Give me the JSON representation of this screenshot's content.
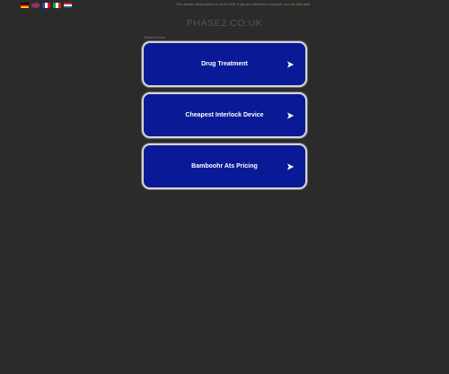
{
  "topbar": {
    "flags": [
      "flag-de-icon",
      "flag-gb-icon",
      "flag-fr-icon",
      "flag-it-icon",
      "flag-nl-icon"
    ],
    "disclaimer_text": "This domain name expired on 01.01.2024. If you are interested in buying it, you can",
    "disclaimer_link": "click here"
  },
  "domain": {
    "title": "PHASE2.CO.UK"
  },
  "related": {
    "label": "Related Links",
    "links": [
      {
        "label": "Drug Treatment"
      },
      {
        "label": "Cheapest Interlock Device"
      },
      {
        "label": "Bamboohr Ats Pricing"
      }
    ]
  },
  "colors": {
    "background": "#2b2b2b",
    "link_box": "#0a1a96",
    "link_border": "#d7d7d7",
    "link_text": "#ffffff",
    "disclaimer_link": "#c8962c"
  }
}
